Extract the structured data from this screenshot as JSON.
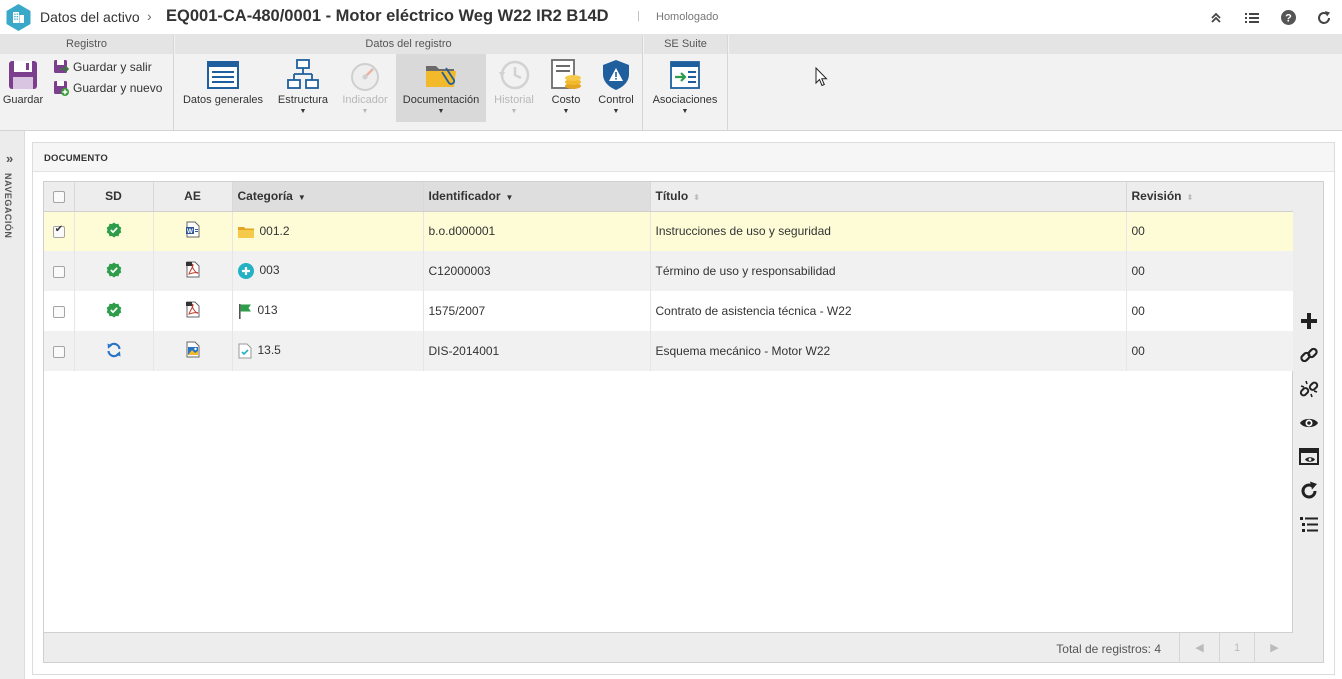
{
  "header": {
    "module_title": "Datos del activo",
    "separator": "›",
    "record_title": "EQ001-CA-480/0001 - Motor eléctrico Weg W22 IR2 B14D",
    "pipe": "|",
    "status": "Homologado",
    "actions": [
      "collapse-icon",
      "list-icon",
      "help-icon",
      "refresh-icon"
    ]
  },
  "ribbon": {
    "groups": {
      "registro": "Registro",
      "datos": "Datos del registro",
      "suite": "SE Suite"
    },
    "guardar": "Guardar",
    "guardar_salir": "Guardar y salir",
    "guardar_nuevo": "Guardar y nuevo",
    "datos_generales": "Datos generales",
    "estructura": "Estructura",
    "indicador": "Indicador",
    "documentacion": "Documentación",
    "historial": "Historial",
    "costo": "Costo",
    "control": "Control",
    "asociaciones": "Asociaciones",
    "caret": "▼"
  },
  "nav": {
    "chevron": "»",
    "label": "NAVEGACIÓN"
  },
  "panel": {
    "title": "DOCUMENTO",
    "columns": {
      "sd": "SD",
      "ae": "AE",
      "categoria": "Categoría",
      "identificador": "Identificador",
      "titulo": "Título",
      "revision": "Revisión"
    },
    "sort_desc": "▼",
    "sort_both": "⬍",
    "rows": [
      {
        "checked": true,
        "sd": "approved-icon",
        "ae": "word-doc-icon",
        "cat_icon": "folder-icon",
        "categoria": "001.2",
        "identificador": "b.o.d000001",
        "titulo": "Instrucciones de uso y seguridad",
        "revision": "00"
      },
      {
        "checked": false,
        "sd": "approved-icon",
        "ae": "pdf-doc-icon",
        "cat_icon": "plus-circle-icon",
        "categoria": "003",
        "identificador": "C12000003",
        "titulo": "Término de uso y responsabilidad",
        "revision": "00"
      },
      {
        "checked": false,
        "sd": "approved-icon",
        "ae": "pdf-doc-icon",
        "cat_icon": "flag-icon",
        "categoria": "013",
        "identificador": "1575/2007",
        "titulo": "Contrato de asistencia técnica - W22",
        "revision": "00"
      },
      {
        "checked": false,
        "sd": "revision-cycle-icon",
        "ae": "image-doc-icon",
        "cat_icon": "checked-doc-icon",
        "categoria": "13.5",
        "identificador": "DIS-2014001",
        "titulo": "Esquema mecánico - Motor W22",
        "revision": "00"
      }
    ],
    "footer": {
      "total": "Total de registros: 4",
      "page": "1",
      "prev": "◀",
      "next": "▶"
    },
    "side_tools": [
      "add-icon",
      "link-icon",
      "unlink-icon",
      "view-icon",
      "preview-window-icon",
      "reload-icon",
      "details-list-icon"
    ]
  },
  "colors": {
    "accent": "#3aa8c9",
    "approved_green": "#2e9d4a",
    "selected_row": "#fdfcd7",
    "folder_yellow": "#f2b92a"
  }
}
